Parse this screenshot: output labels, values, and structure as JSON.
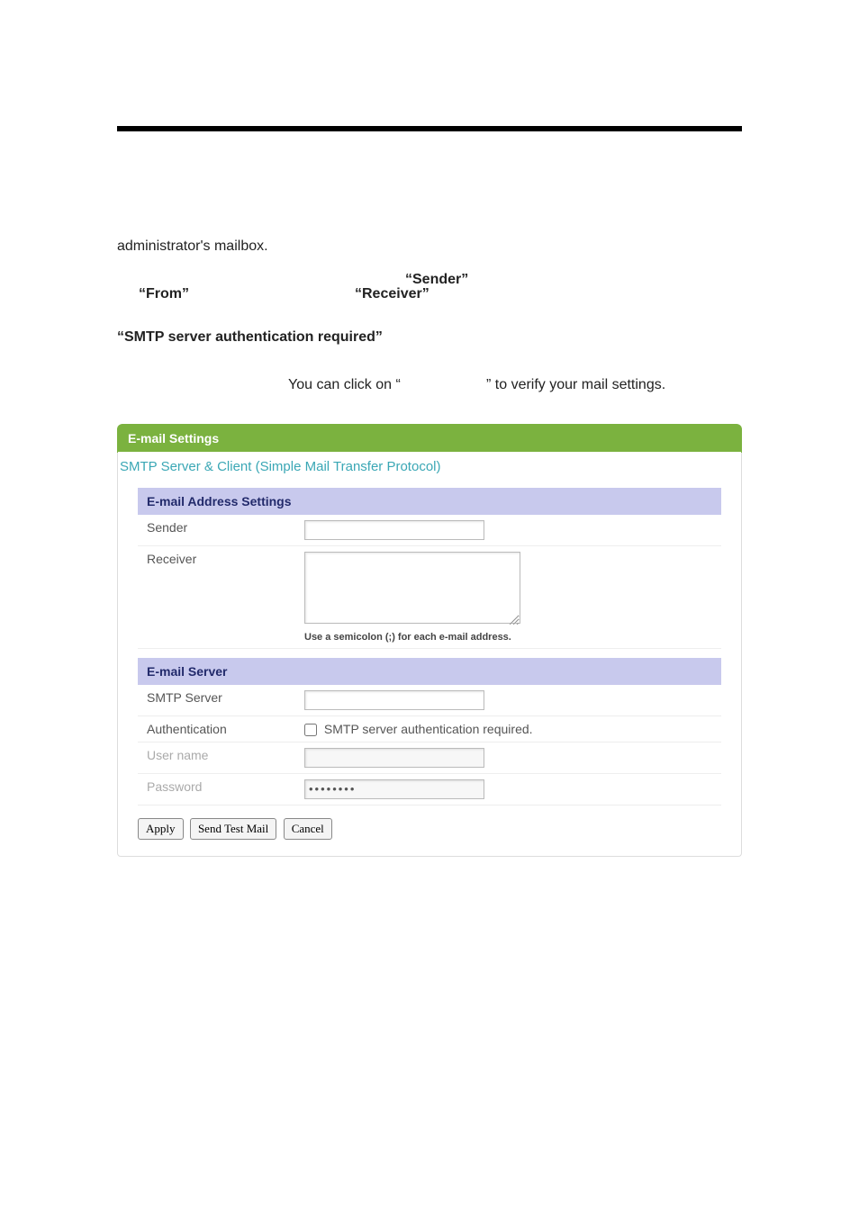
{
  "body": {
    "line1": "administrator's mailbox.",
    "sender_q": "“Sender”",
    "from_q": "“From”",
    "receiver_q": "“Receiver”",
    "smtp_auth_q": "“SMTP  server  authentication  required”",
    "click_pre": "You can click on “",
    "click_post": "” to verify your mail settings."
  },
  "panel": {
    "title": "E-mail Settings",
    "fieldset_label": "SMTP Server & Client (Simple Mail Transfer Protocol)",
    "addr_section": "E-mail Address Settings",
    "sender_label": "Sender",
    "sender_value": "",
    "receiver_label": "Receiver",
    "receiver_value": "",
    "receiver_hint": "Use a semicolon (;) for each e-mail address.",
    "server_section": "E-mail Server",
    "smtp_server_label": "SMTP Server",
    "smtp_server_value": "",
    "auth_label": "Authentication",
    "auth_checkbox_label": "SMTP server authentication required.",
    "auth_checked": false,
    "username_label": "User name",
    "username_value": "",
    "password_label": "Password",
    "password_value": "••••••••",
    "btn_apply": "Apply",
    "btn_send": "Send Test Mail",
    "btn_cancel": "Cancel"
  }
}
